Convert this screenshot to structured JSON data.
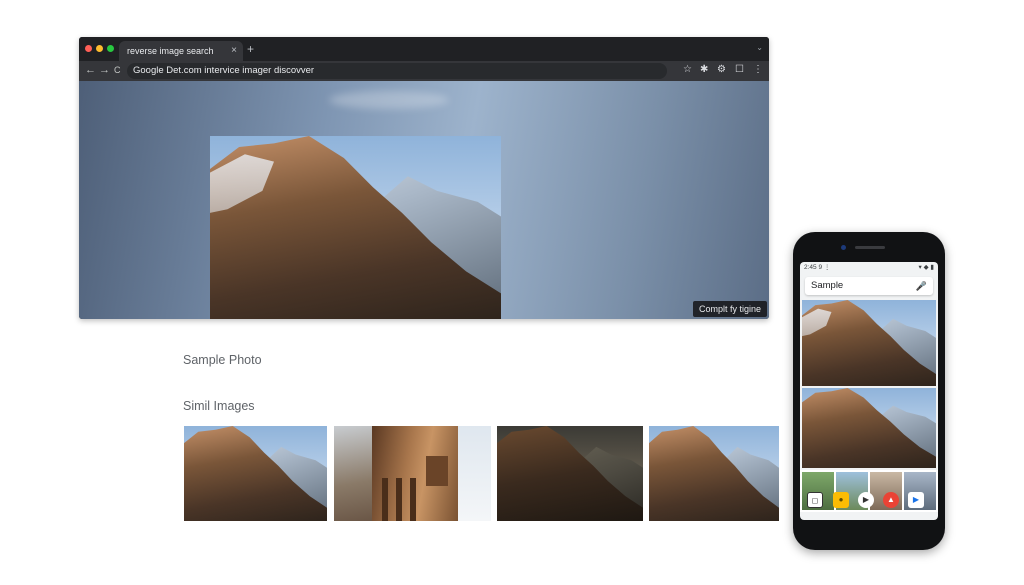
{
  "browser": {
    "tab_title": "reverse image search",
    "tab_close": "×",
    "new_tab": "+",
    "window_control": "⌄",
    "nav": {
      "back": "←",
      "forward": "→",
      "reload": "C"
    },
    "url": "Google Det.com intervice imager discovver",
    "toolbar_icons": [
      "☆",
      "✱",
      "⚙",
      "☐",
      "⋮"
    ],
    "overlay_button": "Complt fy tigine",
    "traffic_lights": [
      "#ff5f57",
      "#febc2e",
      "#28c840"
    ]
  },
  "page": {
    "photo_label": "Sample Photo",
    "similar_label": "Simil Images"
  },
  "phone": {
    "status_left": "2:45 9 ⋮",
    "status_right": "▾ ◆ ▮",
    "search_value": "Sample",
    "mic_icon": "🎤",
    "app_icons": [
      "◻",
      "●",
      "▶",
      "▲",
      "▶"
    ]
  },
  "colors": {
    "window_bg": "#202124",
    "accent": "#1a73e8"
  }
}
